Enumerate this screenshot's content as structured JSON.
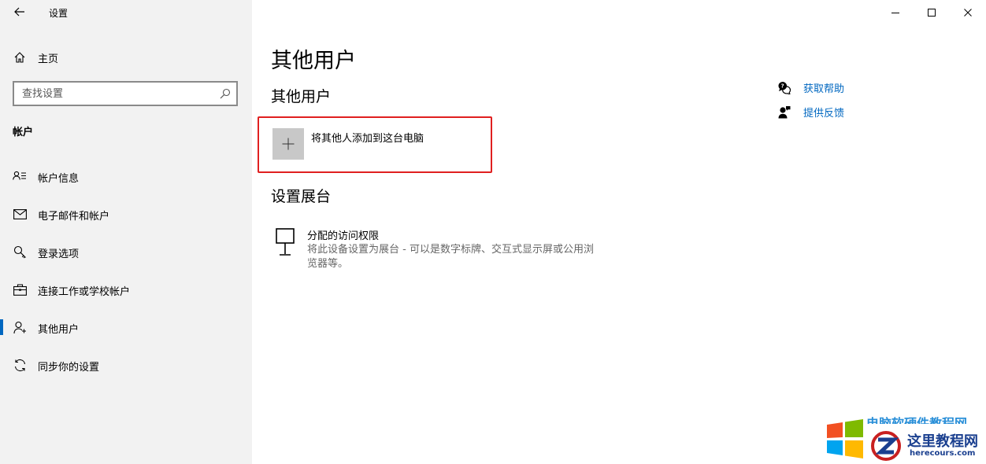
{
  "app": {
    "title": "设置"
  },
  "sidebar": {
    "home_label": "主页",
    "search_placeholder": "查找设置",
    "section_label": "帐户",
    "items": [
      {
        "label": "帐户信息",
        "icon": "account-info-icon",
        "selected": false
      },
      {
        "label": "电子邮件和帐户",
        "icon": "mail-icon",
        "selected": false
      },
      {
        "label": "登录选项",
        "icon": "key-icon",
        "selected": false
      },
      {
        "label": "连接工作或学校帐户",
        "icon": "briefcase-icon",
        "selected": false
      },
      {
        "label": "其他用户",
        "icon": "person-add-icon",
        "selected": true
      },
      {
        "label": "同步你的设置",
        "icon": "sync-icon",
        "selected": false
      }
    ]
  },
  "main": {
    "page_title": "其他用户",
    "other_users_heading": "其他用户",
    "add_user_label": "将其他人添加到这台电脑",
    "kiosk_heading": "设置展台",
    "kiosk": {
      "title": "分配的访问权限",
      "description_line1": "将此设备设置为展台 - 可以是数字标牌、交互式显示屏或公用浏",
      "description_line2": "览器等。"
    }
  },
  "help_links": {
    "get_help": "获取帮助",
    "give_feedback": "提供反馈"
  },
  "watermark": {
    "top_text": "电脑软硬件教程网",
    "cn_text": "这里教程网",
    "url": "herecours.com"
  },
  "colors": {
    "accent": "#0067c0",
    "sidebar_bg": "#f2f2f2",
    "highlight_border": "#e02020"
  }
}
